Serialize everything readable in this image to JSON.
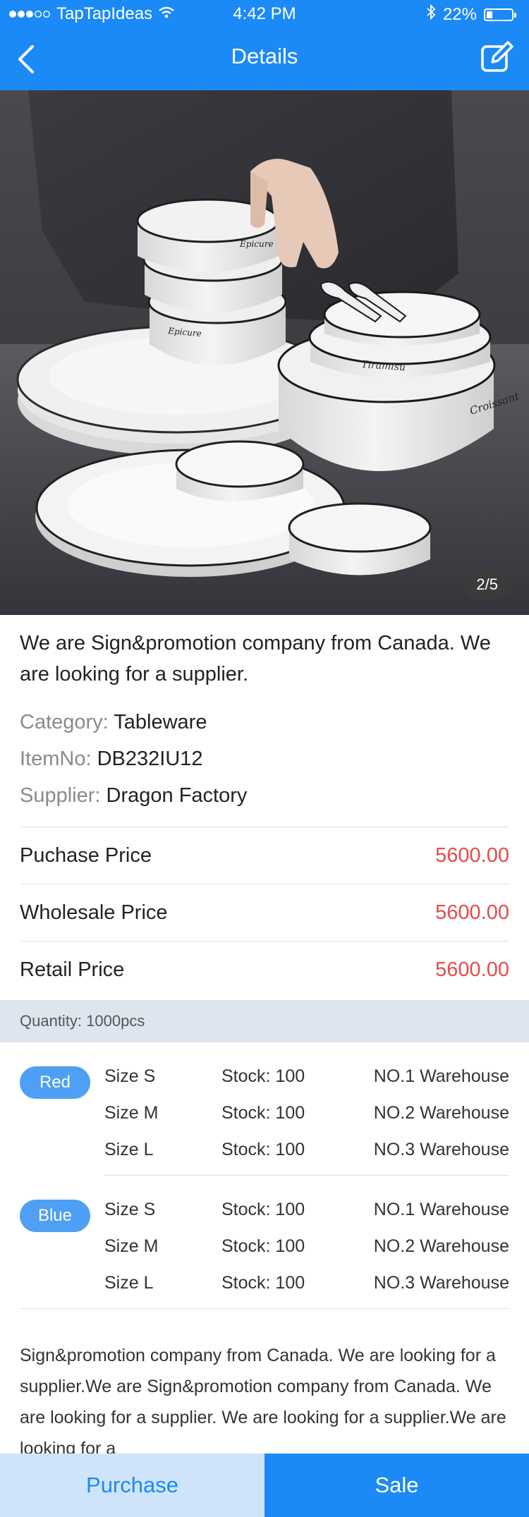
{
  "status_bar": {
    "carrier": "TapTapIdeas",
    "time": "4:42 PM",
    "battery": "22%"
  },
  "navbar": {
    "title": "Details",
    "back_icon": "chevron-left-icon",
    "edit_icon": "edit-icon"
  },
  "gallery": {
    "indicator": "2/5",
    "current": 2,
    "total": 5,
    "dish_labels": [
      "Epicure",
      "Epicure",
      "Tiramisu",
      "Croissant"
    ]
  },
  "product": {
    "description": "We are Sign&promotion company from Canada. We are looking for a supplier.",
    "category_label": "Category:",
    "category_value": "Tableware",
    "item_label": "ItemNo:",
    "item_value": "DB232IU12",
    "supplier_label": "Supplier:",
    "supplier_value": "Dragon Factory"
  },
  "prices": [
    {
      "label": "Puchase Price",
      "value": "5600.00"
    },
    {
      "label": "Wholesale Price",
      "value": "5600.00"
    },
    {
      "label": "Retail Price",
      "value": "5600.00"
    }
  ],
  "quantity": "Quantity: 1000pcs",
  "variants": [
    {
      "color": "Red",
      "rows": [
        {
          "size": "Size S",
          "stock": "Stock: 100",
          "warehouse": "NO.1 Warehouse"
        },
        {
          "size": "Size M",
          "stock": "Stock: 100",
          "warehouse": "NO.2 Warehouse"
        },
        {
          "size": "Size L",
          "stock": "Stock: 100",
          "warehouse": "NO.3 Warehouse"
        }
      ]
    },
    {
      "color": "Blue",
      "rows": [
        {
          "size": "Size S",
          "stock": "Stock: 100",
          "warehouse": "NO.1 Warehouse"
        },
        {
          "size": "Size M",
          "stock": "Stock: 100",
          "warehouse": "NO.2 Warehouse"
        },
        {
          "size": "Size L",
          "stock": "Stock: 100",
          "warehouse": "NO.3 Warehouse"
        }
      ]
    }
  ],
  "long_description": "Sign&promotion company from Canada. We are looking for a supplier.We are Sign&promotion company from Canada. We are looking for a supplier. We are looking for a supplier.We are looking for a",
  "actions": {
    "purchase": "Purchase",
    "sale": "Sale"
  },
  "colors": {
    "primary": "#1b8af6",
    "price": "#e54b4b",
    "pill": "#4f9ff5",
    "quantity_bg": "#dde6ef",
    "purchase_bg": "#cfe4fb"
  }
}
